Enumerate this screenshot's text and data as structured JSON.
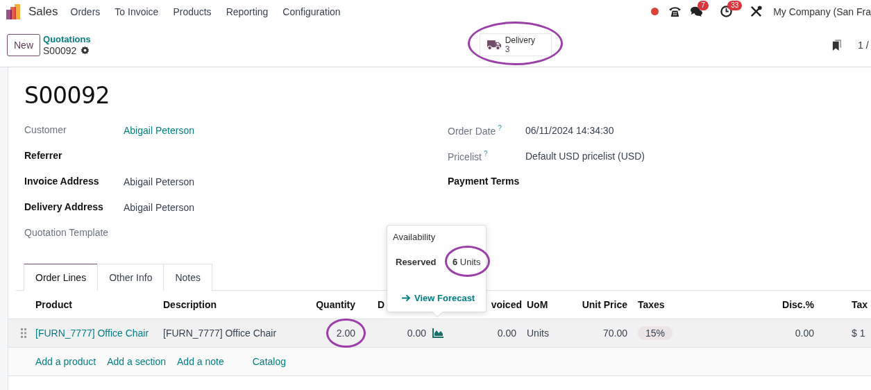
{
  "app": {
    "name": "Sales",
    "menu": [
      "Orders",
      "To Invoice",
      "Products",
      "Reporting",
      "Configuration"
    ]
  },
  "systray": {
    "chat_count": "7",
    "activity_count": "33",
    "company": "My Company (San Fra"
  },
  "control_panel": {
    "new_button": "New",
    "breadcrumb": "Quotations",
    "record": "S00092",
    "smart_button": {
      "label": "Delivery",
      "count": "3",
      "annotated": true
    },
    "pager": "1 /"
  },
  "form": {
    "title": "S00092",
    "left_fields": [
      {
        "label": "Customer",
        "bold": false,
        "value": "Abigail Peterson",
        "kind": "link"
      },
      {
        "label": "Referrer",
        "bold": true
      },
      {
        "label": "Invoice Address",
        "bold": true,
        "value": "Abigail Peterson",
        "kind": "plain"
      },
      {
        "label": "Delivery Address",
        "bold": true,
        "value": "Abigail Peterson",
        "kind": "plain"
      },
      {
        "label": "Quotation Template",
        "bold": false
      }
    ],
    "right_fields": [
      {
        "label": "Order Date",
        "bold": false,
        "help": "?",
        "value": "06/11/2024 14:34:30",
        "kind": "plain"
      },
      {
        "label": "Pricelist",
        "bold": false,
        "help": "?",
        "value": "Default USD pricelist (USD)",
        "kind": "plain"
      },
      {
        "label": "Payment Terms",
        "bold": true
      }
    ]
  },
  "tabs": [
    {
      "label": "Order Lines",
      "selected": true
    },
    {
      "label": "Other Info",
      "selected": false
    },
    {
      "label": "Notes",
      "selected": false
    }
  ],
  "table": {
    "columns": [
      "Product",
      "Description",
      "Quantity",
      "D",
      "voiced",
      "UoM",
      "Unit Price",
      "Taxes",
      "Disc.%",
      "Tax"
    ],
    "rows": [
      {
        "product": "[FURN_7777] Office Chair",
        "description": "[FURN_7777] Office Chair",
        "quantity": "2.00",
        "quantity_annotated": true,
        "delivered": "0.00",
        "invoiced": "0.00",
        "uom": "Units",
        "unit_price": "70.00",
        "tax": "15%",
        "discount": "0.00",
        "tax_incl": "$ 1"
      }
    ],
    "add_links": [
      "Add a product",
      "Add a section",
      "Add a note",
      "Catalog"
    ]
  },
  "popover": {
    "title": "Availability",
    "label": "Reserved",
    "value": "**6** Units",
    "value_annotated": true,
    "link": "View Forecast"
  }
}
